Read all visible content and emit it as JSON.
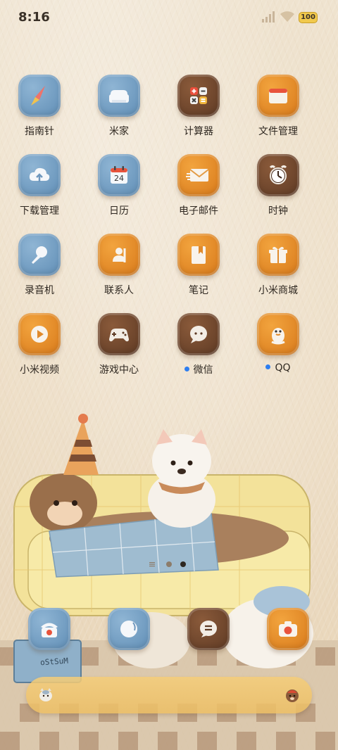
{
  "status_bar": {
    "time": "8:16",
    "battery": "100",
    "icons": [
      "signal-icon",
      "wifi-icon",
      "battery-icon"
    ]
  },
  "apps": [
    {
      "label": "指南针",
      "icon": "compass-icon",
      "color": "blue"
    },
    {
      "label": "米家",
      "icon": "mijia-sofa-icon",
      "color": "blue"
    },
    {
      "label": "计算器",
      "icon": "calculator-icon",
      "color": "brown"
    },
    {
      "label": "文件管理",
      "icon": "folder-icon",
      "color": "orange"
    },
    {
      "label": "下载管理",
      "icon": "download-cloud-icon",
      "color": "blue"
    },
    {
      "label": "日历",
      "icon": "calendar-icon",
      "color": "blue",
      "badge_text": "24"
    },
    {
      "label": "电子邮件",
      "icon": "mail-icon",
      "color": "orange"
    },
    {
      "label": "时钟",
      "icon": "alarm-clock-icon",
      "color": "brown"
    },
    {
      "label": "录音机",
      "icon": "microphone-icon",
      "color": "blue"
    },
    {
      "label": "联系人",
      "icon": "contacts-icon",
      "color": "orange"
    },
    {
      "label": "笔记",
      "icon": "notes-icon",
      "color": "orange"
    },
    {
      "label": "小米商城",
      "icon": "gift-icon",
      "color": "orange"
    },
    {
      "label": "小米视频",
      "icon": "play-icon",
      "color": "orange"
    },
    {
      "label": "游戏中心",
      "icon": "gamepad-icon",
      "color": "brown"
    },
    {
      "label": "微信",
      "icon": "chat-bubble-icon",
      "color": "brown",
      "new_dot": true
    },
    {
      "label": "QQ",
      "icon": "penguin-icon",
      "color": "orange",
      "new_dot": true
    }
  ],
  "dock": [
    {
      "icon": "phone-icon",
      "color": "blue"
    },
    {
      "icon": "messages-icon",
      "color": "blue"
    },
    {
      "icon": "menu-bubble-icon",
      "color": "brown"
    },
    {
      "icon": "camera-icon",
      "color": "orange"
    }
  ],
  "page_indicator": {
    "pages": 2,
    "current": 2
  },
  "wallpaper_sign": "oStSuM",
  "colors": {
    "blue": "#6f9cc2",
    "orange": "#e58c2a",
    "brown": "#6e4530",
    "accent_dot": "#2e7ef0"
  }
}
